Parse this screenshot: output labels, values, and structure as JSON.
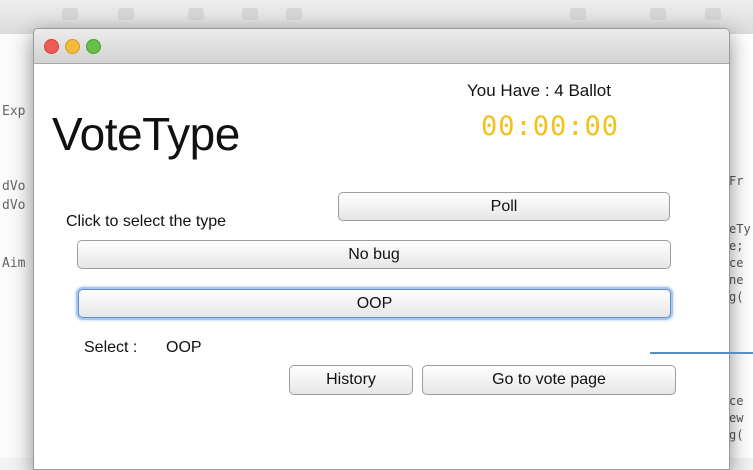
{
  "window": {
    "heading": "VoteType",
    "ballot_text": "You Have : 4 Ballot",
    "timer": "00:00:00",
    "hint": "Click to select the type",
    "buttons": {
      "poll": "Poll",
      "no_bug": "No bug",
      "oop": "OOP",
      "history": "History",
      "go_to_vote": "Go to vote page"
    },
    "selection": {
      "label": "Select :",
      "value": "OOP"
    }
  },
  "background_editor": {
    "left_fragments": [
      "Exp",
      "dVo",
      "dVo",
      "Aim"
    ],
    "right_fragments": [
      "Fr",
      "eTy",
      "e;",
      "ce",
      "ne",
      "g(",
      "ce",
      "ew",
      "g("
    ]
  },
  "colors": {
    "timer": "#f2c21c",
    "focus_ring": "#5f8ec8",
    "close": "#ec5b55",
    "minimize": "#f3bb3a",
    "zoom": "#66c04a"
  }
}
